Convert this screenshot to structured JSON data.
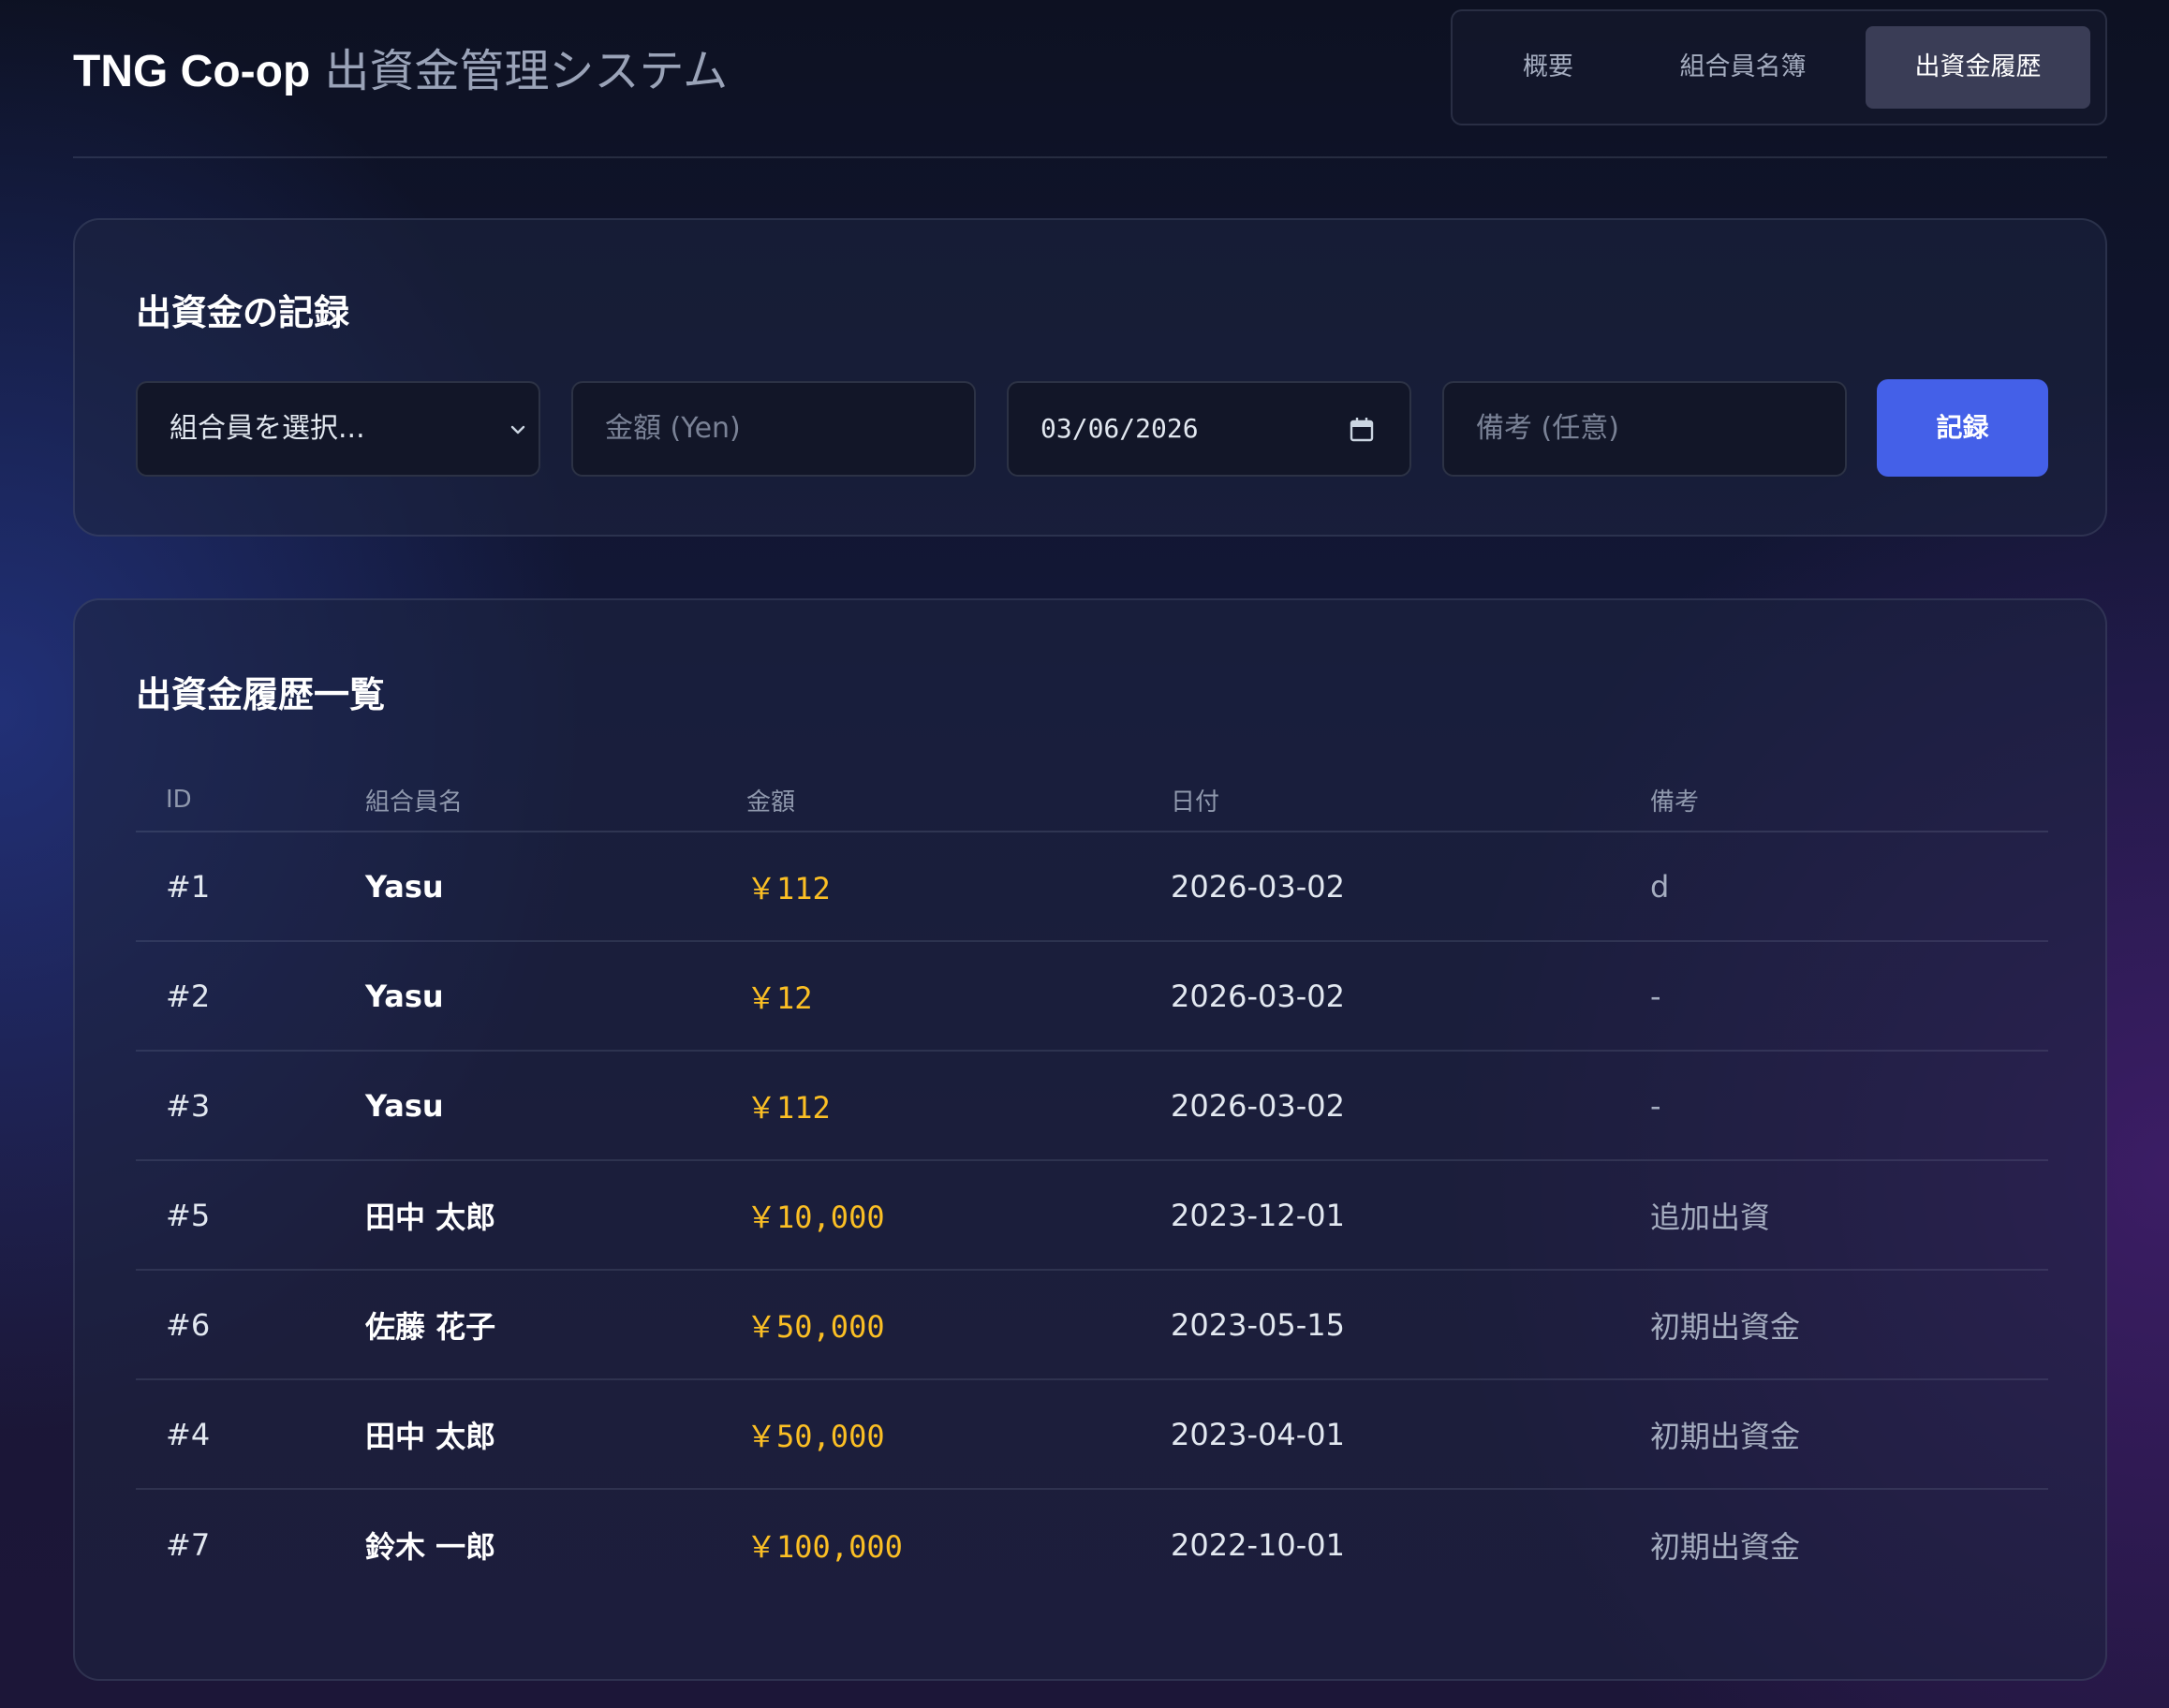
{
  "header": {
    "brand": "TNG Co-op",
    "subtitle": "出資金管理システム",
    "tabs": [
      {
        "label": "概要",
        "active": false
      },
      {
        "label": "組合員名簿",
        "active": false
      },
      {
        "label": "出資金履歴",
        "active": true
      }
    ]
  },
  "form": {
    "title": "出資金の記録",
    "member_select": "組合員を選択...",
    "amount_placeholder": "金額 (Yen)",
    "date_value": "03/06/2026",
    "note_placeholder": "備考 (任意)",
    "submit_label": "記録",
    "accent": "#4460e8"
  },
  "history": {
    "title": "出資金履歴一覧",
    "columns": [
      "ID",
      "組合員名",
      "金額",
      "日付",
      "備考"
    ],
    "rows": [
      {
        "id": "#1",
        "name": "Yasu",
        "amount": "￥112",
        "date": "2026-03-02",
        "note": "d"
      },
      {
        "id": "#2",
        "name": "Yasu",
        "amount": "￥12",
        "date": "2026-03-02",
        "note": "-"
      },
      {
        "id": "#3",
        "name": "Yasu",
        "amount": "￥112",
        "date": "2026-03-02",
        "note": "-"
      },
      {
        "id": "#5",
        "name": "田中 太郎",
        "amount": "￥10,000",
        "date": "2023-12-01",
        "note": "追加出資"
      },
      {
        "id": "#6",
        "name": "佐藤 花子",
        "amount": "￥50,000",
        "date": "2023-05-15",
        "note": "初期出資金"
      },
      {
        "id": "#4",
        "name": "田中 太郎",
        "amount": "￥50,000",
        "date": "2023-04-01",
        "note": "初期出資金"
      },
      {
        "id": "#7",
        "name": "鈴木 一郎",
        "amount": "￥100,000",
        "date": "2022-10-01",
        "note": "初期出資金"
      }
    ],
    "amount_color": "#fbbf24"
  }
}
